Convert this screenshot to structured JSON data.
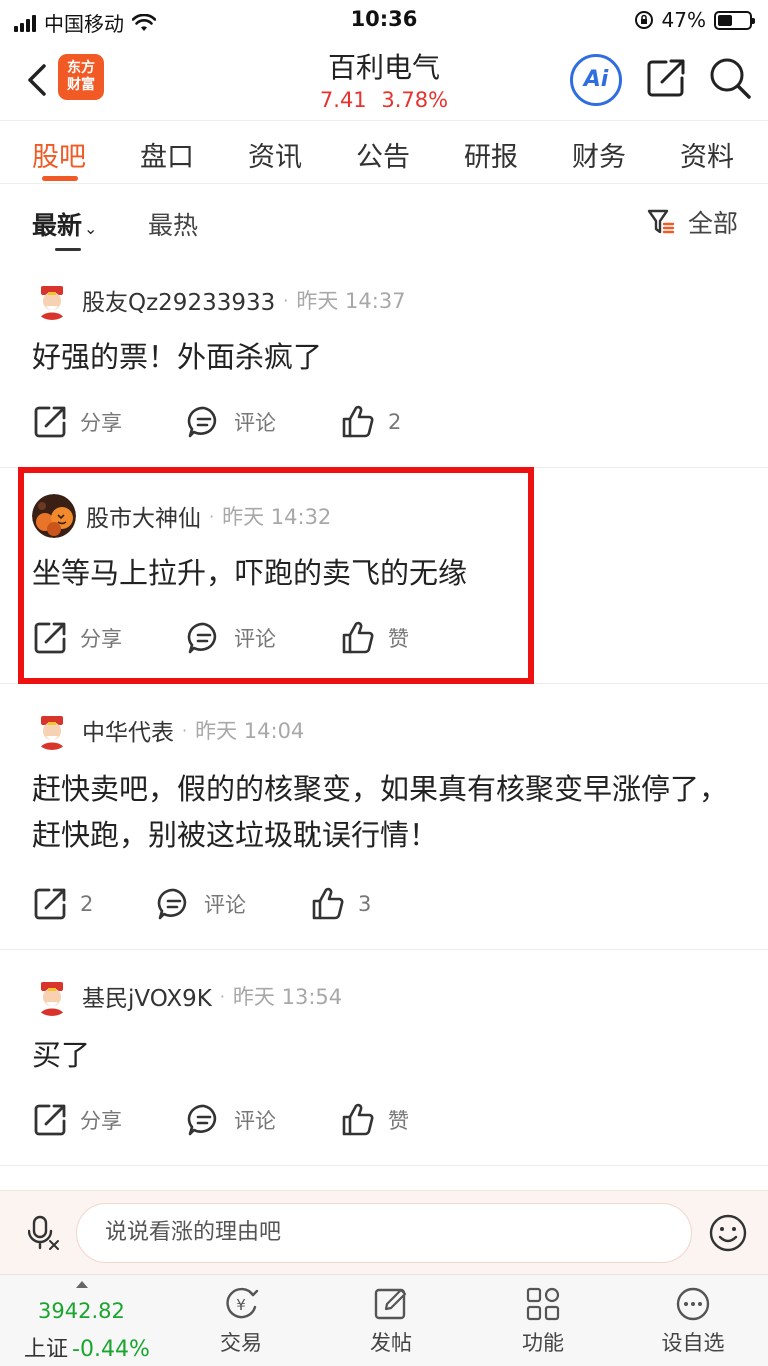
{
  "status_bar": {
    "carrier": "中国移动",
    "time": "10:36",
    "battery": "47%"
  },
  "header": {
    "logo_text_line1": "东方",
    "logo_text_line2": "财富",
    "stock_name": "百利电气",
    "price": "7.41",
    "change_pct": "3.78%",
    "ai_label": "Ai"
  },
  "tabs": [
    "股吧",
    "盘口",
    "资讯",
    "公告",
    "研报",
    "财务",
    "资料"
  ],
  "filter": {
    "newest": "最新",
    "hot": "最热",
    "all": "全部"
  },
  "posts": [
    {
      "author": "股友Qz29233933",
      "time": "昨天 14:37",
      "content": "好强的票！外面杀疯了",
      "share": "分享",
      "comment": "评论",
      "like": "2"
    },
    {
      "author": "股市大神仙",
      "time": "昨天 14:32",
      "content": "坐等马上拉升，吓跑的卖飞的无缘",
      "share": "分享",
      "comment": "评论",
      "like": "赞"
    },
    {
      "author": "中华代表",
      "time": "昨天 14:04",
      "content": "赶快卖吧，假的的核聚变，如果真有核聚变早涨停了，赶快跑，别被这垃圾耽误行情！",
      "share": "2",
      "comment": "评论",
      "like": "3"
    },
    {
      "author": "基民jVOX9K",
      "time": "昨天 13:54",
      "content": "买了",
      "share": "分享",
      "comment": "评论",
      "like": "赞"
    }
  ],
  "reply": {
    "placeholder": "说说看涨的理由吧"
  },
  "bottom": {
    "index_value": "3942.82",
    "index_name": "上证",
    "index_change": "-0.44%",
    "items": [
      "交易",
      "发帖",
      "功能",
      "设自选"
    ]
  },
  "colors": {
    "accent": "#f15a24",
    "up": "#e8322e",
    "down": "#1aa52f",
    "ai_blue": "#2f6de0",
    "highlight": "#ee1111"
  }
}
